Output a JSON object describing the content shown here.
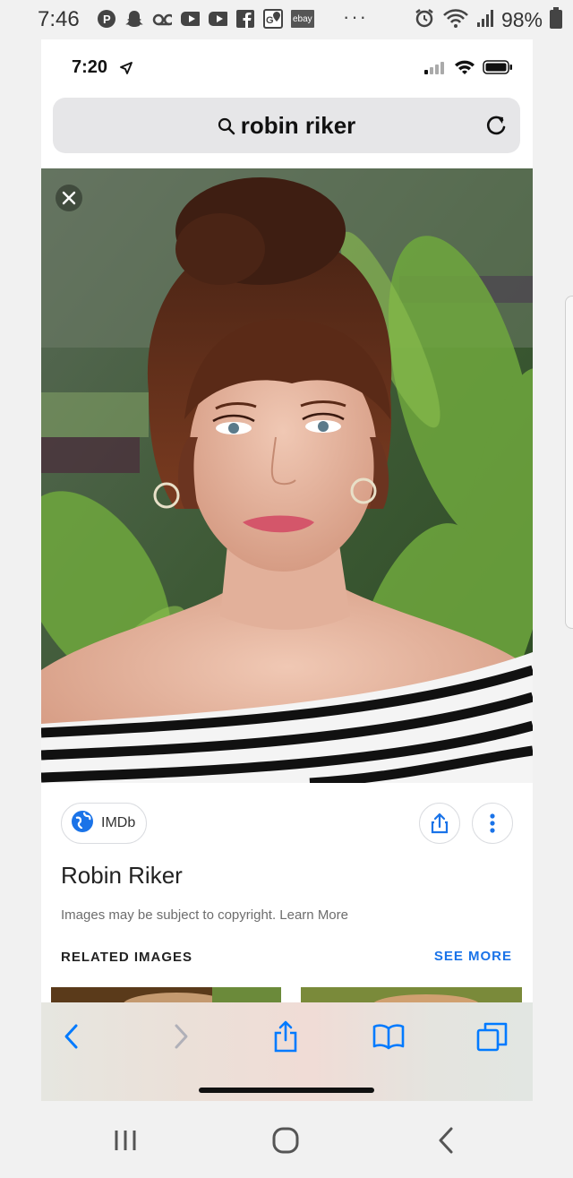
{
  "android_status": {
    "time": "7:46",
    "battery": "98%",
    "overflow": "···",
    "notification_icons": [
      "pandora-icon",
      "snapchat-icon",
      "voicemail-icon",
      "youtube-icon",
      "youtube-icon",
      "facebook-icon",
      "maps-icon",
      "ebay-icon"
    ],
    "ebay_label": "ebay"
  },
  "ios_status": {
    "time": "7:20"
  },
  "browser": {
    "query": "robin riker"
  },
  "result": {
    "source": "IMDb",
    "title": "Robin Riker",
    "copyright": "Images may be subject to copyright. Learn More",
    "related_header": "RELATED IMAGES",
    "see_more": "SEE MORE"
  },
  "colors": {
    "accent": "#1a73e8",
    "ios_blue": "#007aff"
  }
}
